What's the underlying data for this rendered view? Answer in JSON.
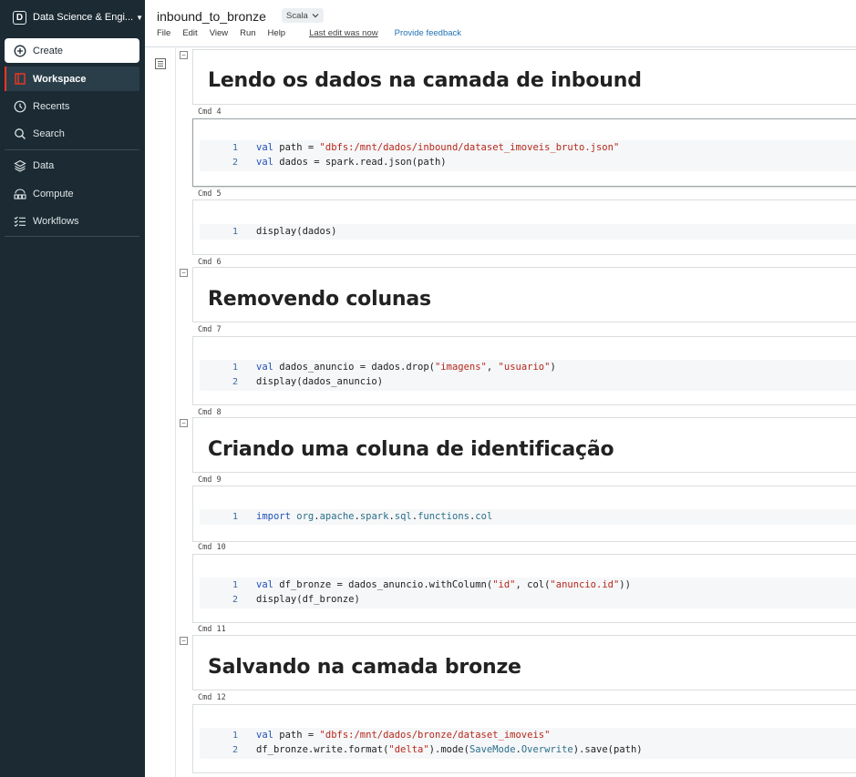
{
  "sidebar": {
    "persona_badge": "D",
    "persona_label": "Data Science & Engi...",
    "create_label": "Create",
    "items": [
      {
        "label": "Workspace",
        "icon": "workspace-icon"
      },
      {
        "label": "Recents",
        "icon": "clock-icon"
      },
      {
        "label": "Search",
        "icon": "search-icon"
      },
      {
        "label": "Data",
        "icon": "data-icon"
      },
      {
        "label": "Compute",
        "icon": "compute-icon"
      },
      {
        "label": "Workflows",
        "icon": "workflows-icon"
      }
    ],
    "accent_color": "#ff3621",
    "background_color": "#1b2a33"
  },
  "header": {
    "title": "inbound_to_bronze",
    "language": "Scala",
    "menu": [
      "File",
      "Edit",
      "View",
      "Run",
      "Help"
    ],
    "last_edit": "Last edit was now",
    "feedback": "Provide feedback"
  },
  "cells": {
    "md1": "Lendo os dados na camada de inbound",
    "cmd4": "Cmd 4",
    "c4l1": "val path = \"dbfs:/mnt/dados/inbound/dataset_imoveis_bruto.json\"",
    "c4l2": "val dados = spark.read.json(path)",
    "cmd5": "Cmd 5",
    "c5l1": "display(dados)",
    "cmd6": "Cmd 6",
    "md2": "Removendo colunas",
    "cmd7": "Cmd 7",
    "c7l1": "val dados_anuncio = dados.drop(\"imagens\", \"usuario\")",
    "c7l2": "display(dados_anuncio)",
    "cmd8": "Cmd 8",
    "md3": "Criando uma coluna de identificação",
    "cmd9": "Cmd 9",
    "c9l1": "import org.apache.spark.sql.functions.col",
    "cmd10": "Cmd 10",
    "c10l1": "val df_bronze = dados_anuncio.withColumn(\"id\", col(\"anuncio.id\"))",
    "c10l2": "display(df_bronze)",
    "cmd11": "Cmd 11",
    "md4": "Salvando na camada bronze",
    "cmd12": "Cmd 12",
    "c12l1": "val path = \"dbfs:/mnt/dados/bronze/dataset_imoveis\"",
    "c12l2": "df_bronze.write.format(\"delta\").mode(SaveMode.Overwrite).save(path)"
  },
  "line_numbers": {
    "one": "1",
    "two": "2"
  }
}
